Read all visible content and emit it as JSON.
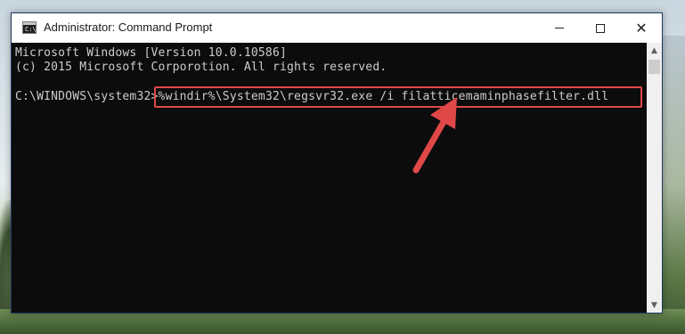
{
  "window": {
    "title": "Administrator: Command Prompt",
    "controls": {
      "minimize": "minimize",
      "maximize": "maximize",
      "close": "✕"
    }
  },
  "console": {
    "lines": [
      "Microsoft Windows [Version 10.0.10586]",
      "(c) 2015 Microsoft Corporotion. All rights reserved."
    ],
    "prompt": "C:\\WINDOWS\\system32>",
    "command": "%windir%\\System32\\regsvr32.exe /i filatticemaminphasefilter.dll"
  },
  "annotation": {
    "highlight_color": "#e04848",
    "arrow_color": "#e04848"
  },
  "icons": {
    "app": "cmd-icon",
    "arrow": "red-arrow-icon"
  }
}
